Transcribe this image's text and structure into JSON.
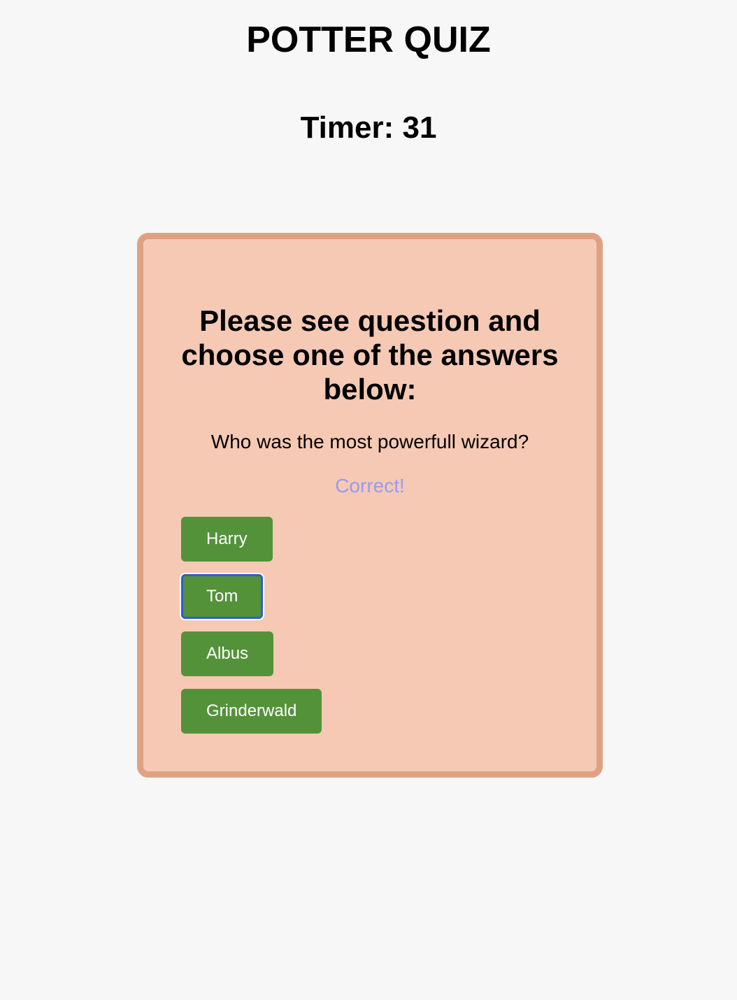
{
  "header": {
    "title": "POTTER QUIZ",
    "timer_label": "Timer: 31"
  },
  "quiz": {
    "instructions": "Please see question and choose one of the answers below:",
    "question": "Who was the most powerfull wizard?",
    "feedback": "Correct!",
    "answers": [
      {
        "label": "Harry"
      },
      {
        "label": "Tom"
      },
      {
        "label": "Albus"
      },
      {
        "label": "Grinderwald"
      }
    ],
    "focused_answer": "Tom"
  },
  "colors": {
    "background": "#f7f7f7",
    "card_fill": "#f5c9b4",
    "card_border": "#dea283",
    "button": "#54923a",
    "feedback_text": "#9a9af0",
    "focus_ring": "#2f5fcc"
  }
}
